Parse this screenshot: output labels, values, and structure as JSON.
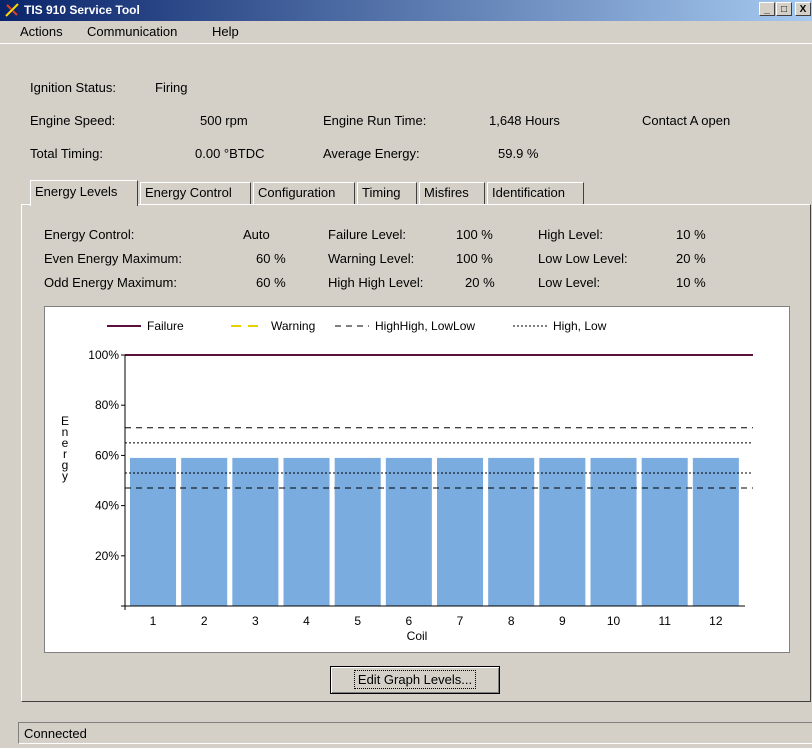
{
  "window": {
    "title": "TIS 910 Service Tool",
    "min_label": "_",
    "max_label": "□",
    "close_label": "X"
  },
  "menu": {
    "items": [
      "Actions",
      "Communication",
      "Help"
    ]
  },
  "status_header": {
    "ignition_label": "Ignition Status:",
    "ignition_value": "Firing",
    "speed_label": "Engine Speed:",
    "speed_value": "500 rpm",
    "runtime_label": "Engine Run Time:",
    "runtime_value": "1,648 Hours",
    "contact_value": "Contact A open",
    "timing_label": "Total Timing:",
    "timing_value": "0.00 °BTDC",
    "energy_label": "Average Energy:",
    "energy_value": "59.9 %"
  },
  "tabs": [
    "Energy Levels",
    "Energy Control",
    "Configuration",
    "Timing",
    "Misfires",
    "Identification"
  ],
  "active_tab": "Energy Levels",
  "energy_panel": {
    "energy_control_label": "Energy Control:",
    "energy_control_value": "Auto",
    "even_max_label": "Even Energy Maximum:",
    "even_max_value": "60 %",
    "odd_max_label": "Odd Energy Maximum:",
    "odd_max_value": "60 %",
    "failure_label": "Failure Level:",
    "failure_value": "100 %",
    "warning_label": "Warning Level:",
    "warning_value": "100 %",
    "highhigh_label": "High High Level:",
    "highhigh_value": "20 %",
    "high_label": "High Level:",
    "high_value": "10 %",
    "lowlow_label": "Low Low Level:",
    "lowlow_value": "20 %",
    "low_label": "Low Level:",
    "low_value": "10 %"
  },
  "chart_data": {
    "type": "bar",
    "xlabel": "Coil",
    "ylabel": "Energy",
    "categories": [
      "1",
      "2",
      "3",
      "4",
      "5",
      "6",
      "7",
      "8",
      "9",
      "10",
      "11",
      "12"
    ],
    "values": [
      59,
      59,
      59,
      59,
      59,
      59,
      59,
      59,
      59,
      59,
      59,
      59
    ],
    "ylim": [
      0,
      100
    ],
    "yticks": [
      "20%",
      "40%",
      "60%",
      "80%",
      "100%"
    ],
    "ytick_values": [
      20,
      40,
      60,
      80,
      100
    ],
    "bar_color": "#7aacdf",
    "legend": [
      {
        "name": "Failure",
        "style": "solid",
        "color": "#5a0f3c"
      },
      {
        "name": "Warning",
        "style": "dashed",
        "color": "#e6d200"
      },
      {
        "name": "HighHigh, LowLow",
        "style": "dashed",
        "color": "#000000"
      },
      {
        "name": "High, Low",
        "style": "dotted",
        "color": "#000000"
      }
    ],
    "lines": [
      {
        "name": "Failure",
        "value": 100
      },
      {
        "name": "HighHigh",
        "value": 71
      },
      {
        "name": "High",
        "value": 65
      },
      {
        "name": "Low",
        "value": 53
      },
      {
        "name": "LowLow",
        "value": 47
      }
    ]
  },
  "edit_button": "Edit Graph Levels...",
  "status_bar": "Connected"
}
